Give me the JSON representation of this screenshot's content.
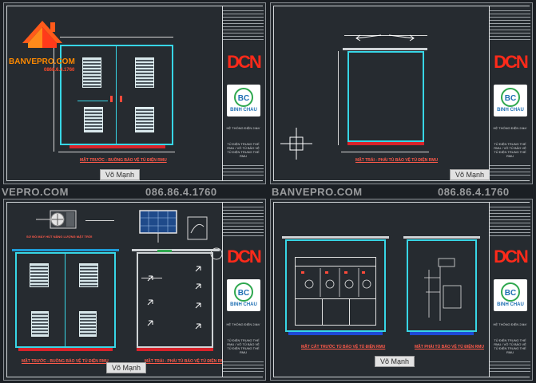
{
  "brand": {
    "name": "BANVEPRO.COM",
    "phone": "0868.6.4.1760",
    "logo_icon": "house-roof-logo"
  },
  "watermarks": {
    "left_site": "VEPRO.COM",
    "left_phone": "086.86.4.1760",
    "right_site": "BANVEPRO.COM",
    "right_phone": "086.86.4.1760"
  },
  "sheets": [
    {
      "caption": "MẶT TRƯỚC - BUỒNG BẢO VỆ TỦ ĐIỆN RMU",
      "signer": "Võ Mạnh",
      "titleblock": {
        "logo_text": "DCN",
        "company": "BINH CHAU",
        "system": "HỆ THỐNG ĐIỆN 24kV",
        "title": "TỦ ĐIỆN TRUNG THẾ RMU / VỎ TỦ BẢO VỆ TỦ ĐIỆN TRUNG THẾ RMU"
      }
    },
    {
      "caption": "MẶT TRÁI - PHẢI TỦ BẢO VỆ TỦ ĐIỆN RMU",
      "signer": "Võ Mạnh",
      "titleblock": {
        "logo_text": "DCN",
        "company": "BINH CHAU",
        "system": "HỆ THỐNG ĐIỆN 24kV",
        "title": "TỦ ĐIỆN TRUNG THẾ RMU / VỎ TỦ BẢO VỆ TỦ ĐIỆN TRUNG THẾ RMU"
      }
    },
    {
      "caption_left": "MẶT TRƯỚC - BUỒNG BẢO VỆ TỦ ĐIỆN RMU",
      "caption_right": "MẶT TRÁI - PHẢI TỦ BẢO VỆ TỦ ĐIỆN RMU",
      "label_solar": "SƠ ĐỒ MÁY HÚT NĂNG LƯỢNG MẶT TRỜI",
      "signer": "Võ Mạnh",
      "titleblock": {
        "logo_text": "DCN",
        "company": "BINH CHAU",
        "system": "HỆ THỐNG ĐIỆN 24kV",
        "title": "TỦ ĐIỆN TRUNG THẾ RMU / VỎ TỦ BẢO VỆ TỦ ĐIỆN TRUNG THẾ RMU"
      }
    },
    {
      "caption_left": "MẶT CẮT TRƯỚC TỦ BẢO VỆ TỦ ĐIỆN RMU",
      "caption_right": "MẶT PHẢI TỦ BẢO VỆ TỦ ĐIỆN RMU",
      "signer": "Võ Mạnh",
      "titleblock": {
        "logo_text": "DCN",
        "company": "BINH CHAU",
        "system": "HỆ THỐNG ĐIỆN 24kV",
        "title": "TỦ ĐIỆN TRUNG THẾ RMU / VỎ TỦ BẢO VỆ TỦ ĐIỆN TRUNG THẾ RMU"
      }
    }
  ]
}
